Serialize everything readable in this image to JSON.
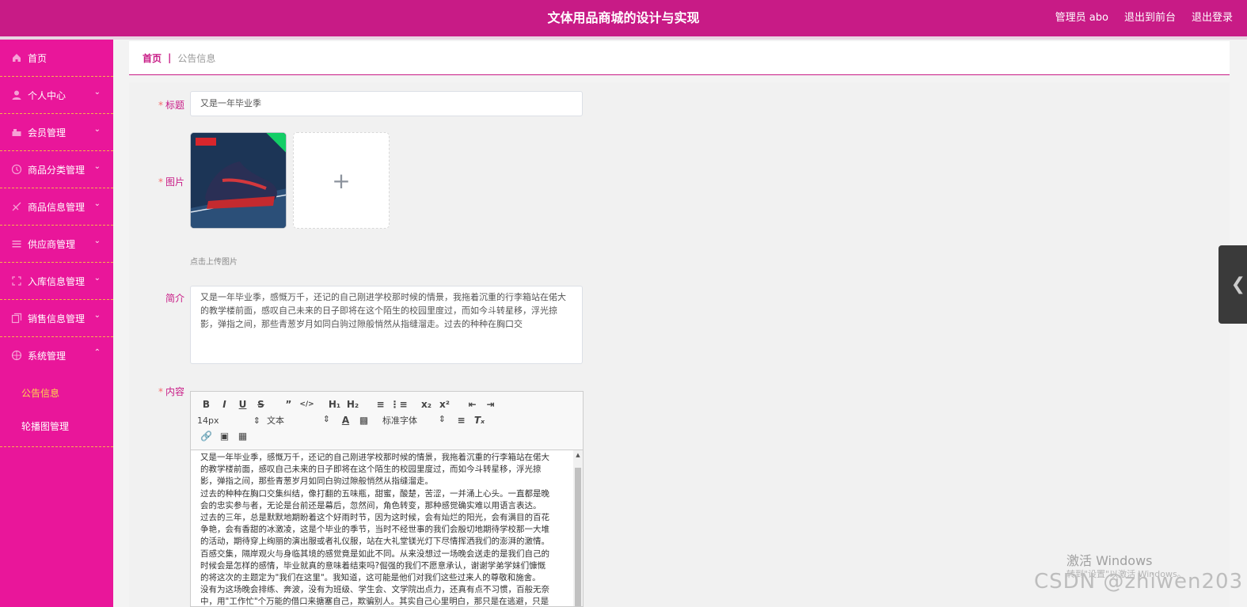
{
  "header": {
    "title": "文体用品商城的设计与实现",
    "user": "管理员 abo",
    "to_front": "退出到前台",
    "logout": "退出登录"
  },
  "sidebar": {
    "items": [
      {
        "label": "首页",
        "icon": "home-icon"
      },
      {
        "label": "个人中心",
        "icon": "user-icon"
      },
      {
        "label": "会员管理",
        "icon": "members-icon"
      },
      {
        "label": "商品分类管理",
        "icon": "category-icon"
      },
      {
        "label": "商品信息管理",
        "icon": "product-icon"
      },
      {
        "label": "供应商管理",
        "icon": "list-icon"
      },
      {
        "label": "入库信息管理",
        "icon": "inbound-icon"
      },
      {
        "label": "销售信息管理",
        "icon": "sales-icon"
      },
      {
        "label": "系统管理",
        "icon": "settings-icon"
      }
    ],
    "sub_items": [
      "公告信息",
      "轮播图管理"
    ]
  },
  "breadcrumb": {
    "home": "首页",
    "separator": "|",
    "current": "公告信息"
  },
  "form": {
    "title_label": "标题",
    "title_value": "又是一年毕业季",
    "image_label": "图片",
    "upload_hint": "点击上传图片",
    "intro_label": "简介",
    "intro_value": "又是一年毕业季，感慨万千，还记的自己刚进学校那时候的情景，我拖着沉重的行李箱站在偌大的教学楼前面，感叹自己未来的日子即将在这个陌生的校园里度过，而如今斗转星移，浮光掠影，弹指之间，那些青葱岁月如同白驹过隙般悄然从指缝溜走。过去的种种在胸口交",
    "content_label": "内容"
  },
  "editor": {
    "toolbar_row1": [
      "B",
      "I",
      "U",
      "S",
      "99",
      "</>",
      "H1",
      "H2",
      "ol",
      "ul",
      "x₂",
      "x²",
      "outdent",
      "indent"
    ],
    "size_select": "14px",
    "type_select": "文本",
    "font_select": "标准字体",
    "lines": [
      "又是一年毕业季，感慨万千，还记的自己刚进学校那时候的情景，我拖着沉重的行李箱站在偌大",
      "的教学楼前面，感叹自己未来的日子即将在这个陌生的校园里度过，而如今斗转星移，浮光掠",
      "影，弹指之间，那些青葱岁月如同白驹过隙般悄然从指缝溜走。",
      "过去的种种在胸口交集纠结，像打翻的五味瓶，甜蜜，酸楚，苦涩，一并涌上心头。一直都是晚",
      "会的忠实参与者，无论是台前还是幕后，忽然间，角色转变，那种感觉确实难以用语言表达。",
      "过去的三年，总是默默地期盼着这个好雨时节，因为这时候，会有灿烂的阳光，会有满目的百花",
      "争艳，会有香甜的冰激凌，这是个毕业的季节，当时不经世事的我们会殷切地期待学校那一大堆",
      "的活动，期待穿上绚丽的演出服或者礼仪服，站在大礼堂镁光灯下尽情挥洒我们的澎湃的激情。",
      "百感交集，隔岸观火与身临其境的感觉竟是如此不同。从来没想过一场晚会送走的是我们自己的",
      "时候会是怎样的感情，毕业就真的意味着结束吗?倔强的我们不愿意承认，谢谢学弟学妹们慷慨",
      "的将这次的主题定为\"我们在这里\"。我知道，这可能是他们对我们这些过来人的尊敬和施舍。",
      "没有为这场晚会排练、奔波，没有为班级、学生会、文学院出点力，还真有点不习惯，百般无奈",
      "中，用\"工作忙\"个万能的借口来搪塞自己，欺骗别人。其实自己心里明白，那只是在逃避，只是"
    ]
  },
  "watermark": {
    "activate": "激活 Windows",
    "activate_sub": "转到\"设置\"以激活 Windows。",
    "csdn": "CSDN @zhiwen203"
  },
  "colors": {
    "header_bg": "#c81b86",
    "sidebar_bg": "#e9169a",
    "active_sub": "#ffd84d"
  }
}
